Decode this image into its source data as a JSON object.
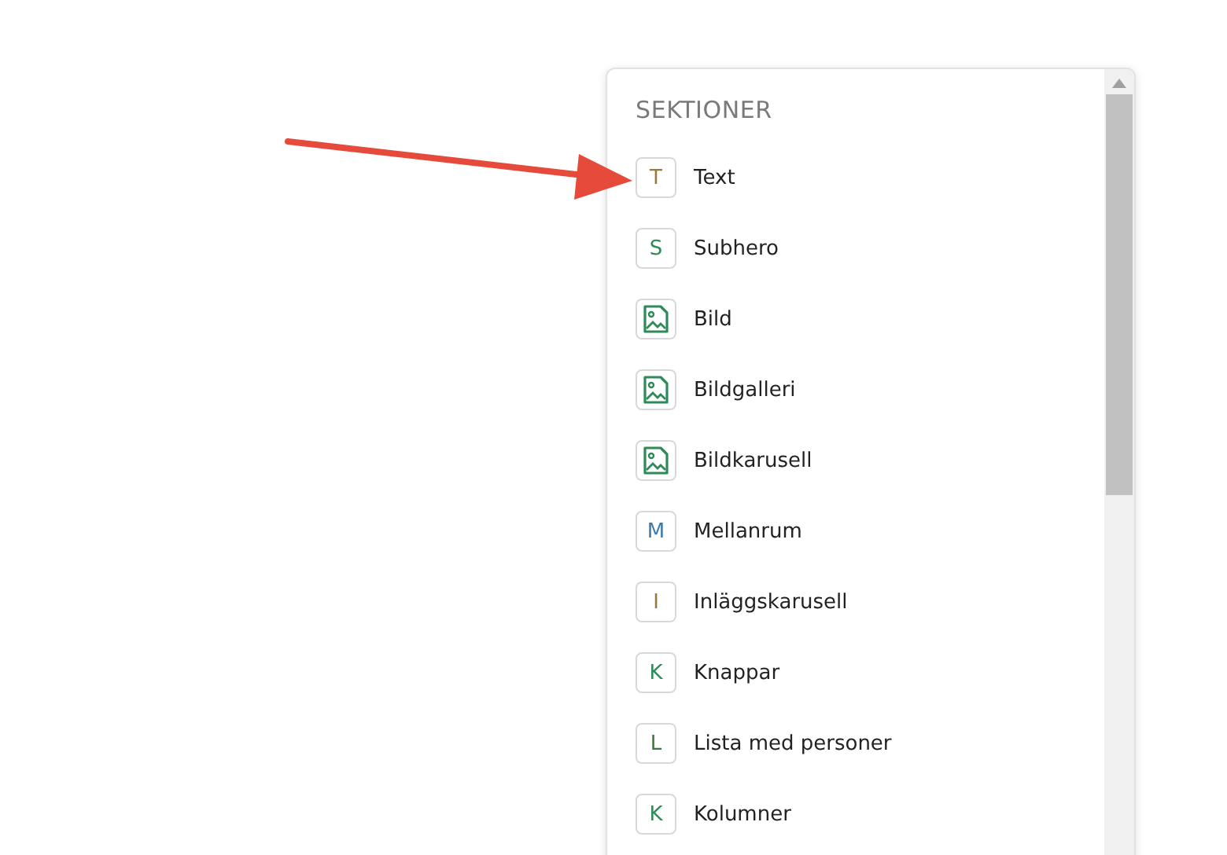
{
  "panel": {
    "title": "SEKTIONER",
    "items": [
      {
        "kind": "letter",
        "glyph": "T",
        "label": "Text",
        "color": "#9a7a3a"
      },
      {
        "kind": "letter",
        "glyph": "S",
        "label": "Subhero",
        "color": "#2e8b57"
      },
      {
        "kind": "image",
        "label": "Bild"
      },
      {
        "kind": "image",
        "label": "Bildgalleri"
      },
      {
        "kind": "image",
        "label": "Bildkarusell"
      },
      {
        "kind": "letter",
        "glyph": "M",
        "label": "Mellanrum",
        "color": "#3a7ab0"
      },
      {
        "kind": "letter",
        "glyph": "I",
        "label": "Inläggskarusell",
        "color": "#9a7a3a"
      },
      {
        "kind": "letter",
        "glyph": "K",
        "label": "Knappar",
        "color": "#2e8b57"
      },
      {
        "kind": "letter",
        "glyph": "L",
        "label": "Lista med personer",
        "color": "#3b7a3a"
      },
      {
        "kind": "letter",
        "glyph": "K",
        "label": "Kolumner",
        "color": "#2e8b57"
      }
    ]
  }
}
